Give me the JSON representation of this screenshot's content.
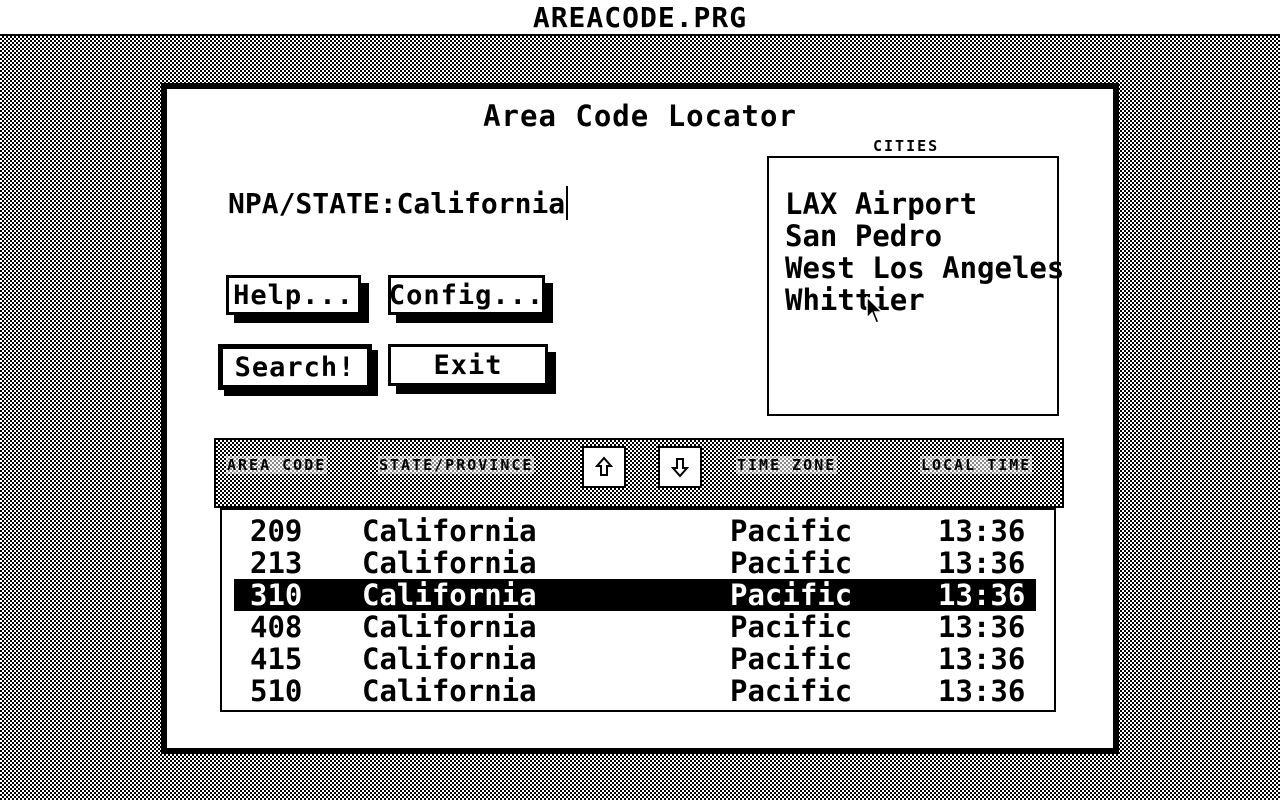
{
  "window": {
    "title": "AREACODE.PRG"
  },
  "dialog": {
    "title": "Area Code Locator",
    "npa_field": {
      "label": "NPA/STATE:",
      "value": "California"
    },
    "buttons": {
      "help": "Help...",
      "config": "Config...",
      "search": "Search!",
      "exit": "Exit"
    },
    "cities": {
      "label": "CITIES",
      "items": [
        "LAX Airport",
        "San Pedro",
        "West Los Angeles",
        "Whittier"
      ]
    },
    "table": {
      "headers": {
        "area_code": "AREA CODE",
        "state": "STATE/PROVINCE",
        "time_zone": "TIME ZONE",
        "local_time": "LOCAL TIME"
      },
      "rows": [
        {
          "code": "209",
          "state": "California",
          "tz": "Pacific",
          "time": "13:36"
        },
        {
          "code": "213",
          "state": "California",
          "tz": "Pacific",
          "time": "13:36"
        },
        {
          "code": "310",
          "state": "California",
          "tz": "Pacific",
          "time": "13:36",
          "selected": true
        },
        {
          "code": "408",
          "state": "California",
          "tz": "Pacific",
          "time": "13:36"
        },
        {
          "code": "415",
          "state": "California",
          "tz": "Pacific",
          "time": "13:36"
        },
        {
          "code": "510",
          "state": "California",
          "tz": "Pacific",
          "time": "13:36"
        }
      ]
    }
  },
  "icons": {
    "scroll_up": "up-arrow-icon",
    "scroll_down": "down-arrow-icon",
    "cursor": "mouse-pointer-icon"
  }
}
